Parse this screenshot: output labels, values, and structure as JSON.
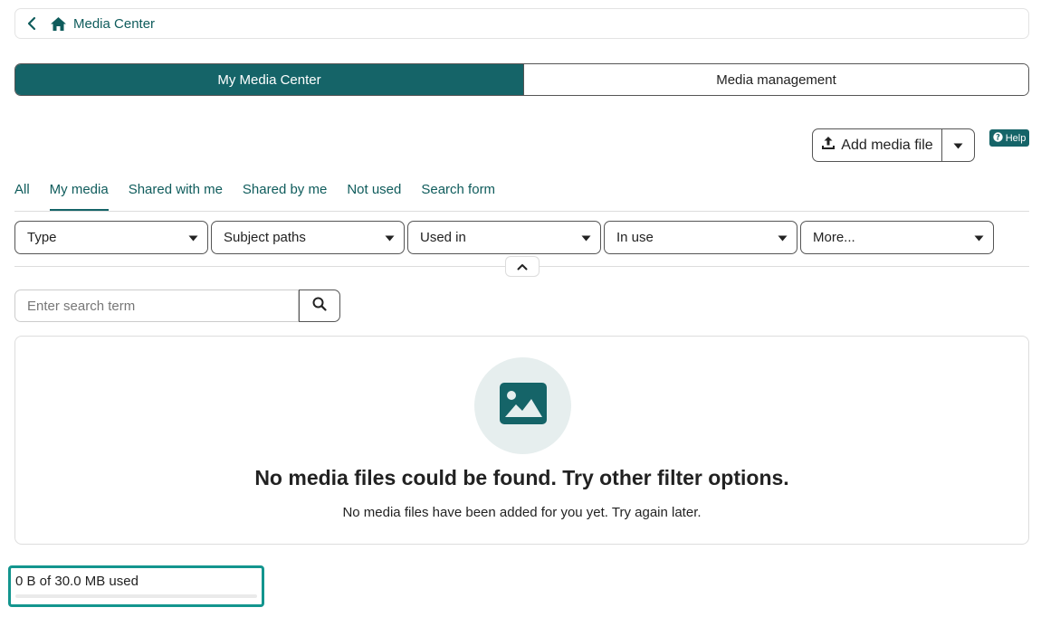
{
  "breadcrumb": {
    "label": "Media Center"
  },
  "mode_tabs": {
    "active": "My Media Center",
    "inactive": "Media management"
  },
  "actions": {
    "add_label": "Add media file",
    "help_label": "Help"
  },
  "filter_tabs": [
    "All",
    "My media",
    "Shared with me",
    "Shared by me",
    "Not used",
    "Search form"
  ],
  "active_filter_tab": "My media",
  "selects": [
    "Type",
    "Subject paths",
    "Used in",
    "In use",
    "More..."
  ],
  "search": {
    "placeholder": "Enter search term",
    "value": ""
  },
  "empty_state": {
    "title": "No media files could be found. Try other filter options.",
    "subtitle": "No media files have been added for you yet. Try again later."
  },
  "usage": {
    "text": "0 B of 30.0 MB used",
    "fraction": 0
  },
  "colors": {
    "accent": "#156468",
    "link": "#0f5c5c",
    "highlight": "#13958e",
    "empty_circle": "#e6eeee"
  },
  "icons": {
    "back": "chevron-left-icon",
    "home": "home-icon",
    "upload": "upload-icon",
    "caret": "caret-down-icon",
    "help": "question-circle-icon",
    "collapse": "chevron-up-icon",
    "search": "search-icon",
    "image": "image-icon"
  }
}
